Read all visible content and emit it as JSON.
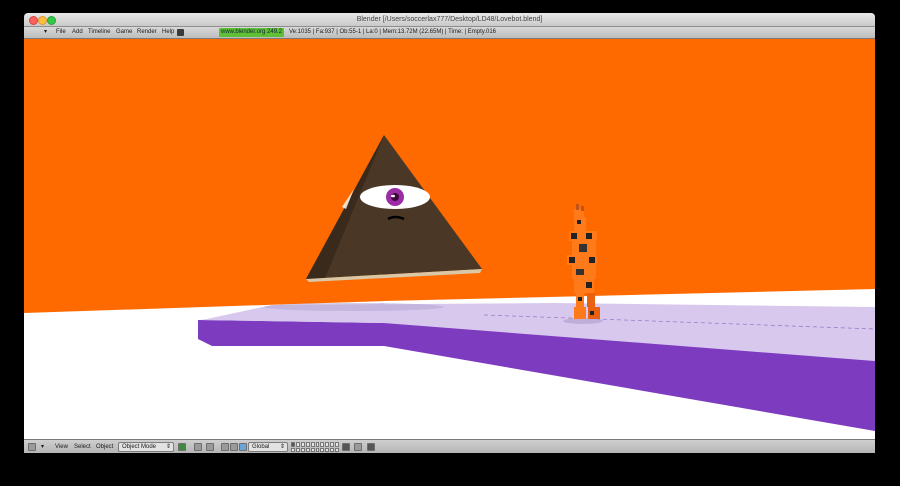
{
  "window": {
    "title": "Blender [/Users/soccerlax777/Desktop/LD48/Lovebot.blend]"
  },
  "menubar": {
    "items": [
      "File",
      "Add",
      "Timeline",
      "Game",
      "Render",
      "Help"
    ],
    "link": "www.blender.org 249.2",
    "stats": "Ve:1035 | Fa:937 | Ob:55-1 | La:0  | Mem:13.72M (22.65M) | Time: | Empty.016"
  },
  "viewport": {
    "background_color": "#ff6a00",
    "floor_color": "#ffffff",
    "platform_top_color": "#d8c8ee",
    "platform_side_color": "#7d3cc0",
    "pyramid_color": "#4a3726"
  },
  "bottombar": {
    "items": [
      "View",
      "Select",
      "Object"
    ],
    "mode": "Object Mode",
    "orientation": "Global"
  },
  "icons": {
    "editor_type": "grid-editor-icon",
    "pivot": "pivot-icon",
    "manipulator": "manipulator-hand-icon",
    "lock": "lock-icon",
    "render": "render-icon"
  }
}
